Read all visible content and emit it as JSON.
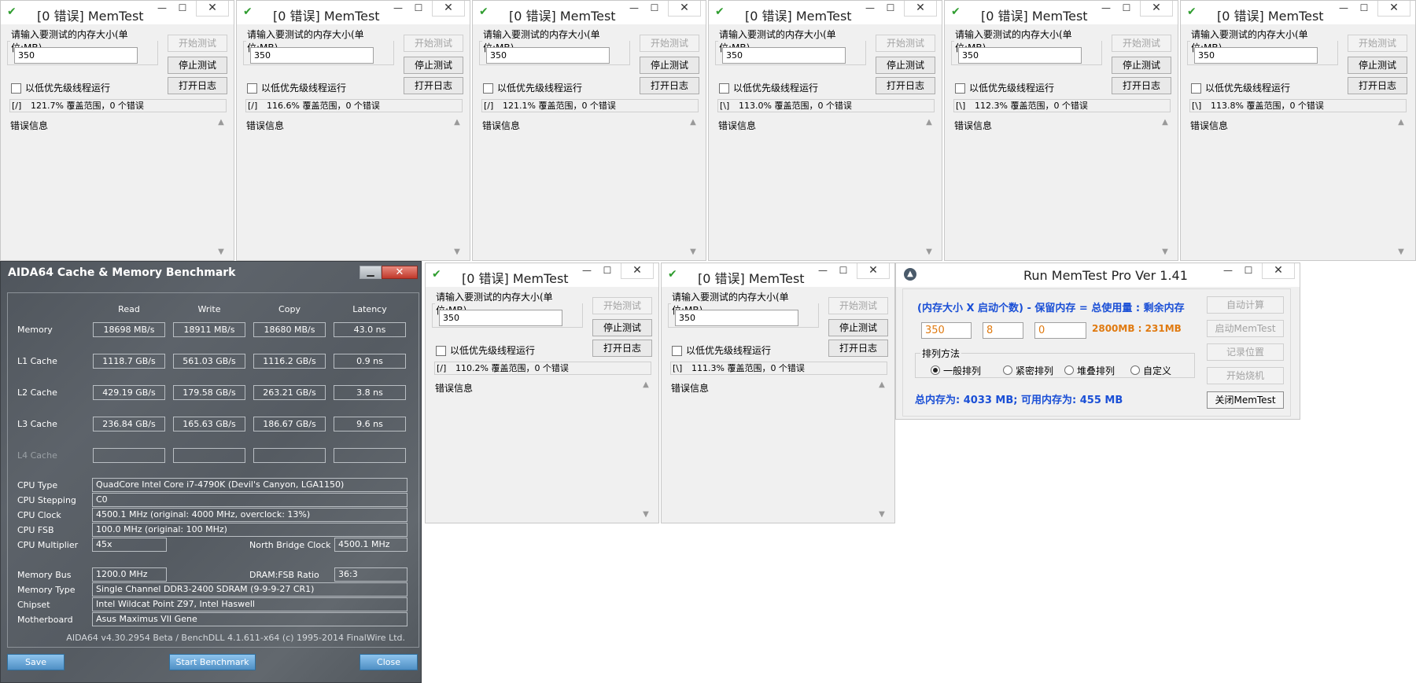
{
  "memtest": {
    "title": "[0 错误] MemTest",
    "size_label": "请输入要测试的内存大小(单位:MB)",
    "size_value": "350",
    "btn_start": "开始测试",
    "btn_stop": "停止测试",
    "btn_log": "打开日志",
    "low_priority": "以低优先级线程运行",
    "error_label": "错误信息",
    "windows": [
      {
        "spinner": "[/]",
        "status": "121.7% 覆盖范围，0 个错误"
      },
      {
        "spinner": "[/]",
        "status": "116.6% 覆盖范围，0 个错误"
      },
      {
        "spinner": "[/]",
        "status": "121.1% 覆盖范围，0 个错误"
      },
      {
        "spinner": "[\\]",
        "status": "113.0% 覆盖范围，0 个错误"
      },
      {
        "spinner": "[\\]",
        "status": "112.3% 覆盖范围，0 个错误"
      },
      {
        "spinner": "[\\]",
        "status": "113.8% 覆盖范围，0 个错误"
      },
      {
        "spinner": "[/]",
        "status": "110.2% 覆盖范围，0 个错误"
      },
      {
        "spinner": "[\\]",
        "status": "111.3% 覆盖范围，0 个错误"
      }
    ]
  },
  "aida": {
    "title": "AIDA64 Cache & Memory Benchmark",
    "columns": {
      "read": "Read",
      "write": "Write",
      "copy": "Copy",
      "latency": "Latency"
    },
    "rows": [
      {
        "label": "Memory",
        "read": "18698 MB/s",
        "write": "18911 MB/s",
        "copy": "18680 MB/s",
        "latency": "43.0 ns"
      },
      {
        "label": "L1 Cache",
        "read": "1118.7 GB/s",
        "write": "561.03 GB/s",
        "copy": "1116.2 GB/s",
        "latency": "0.9 ns"
      },
      {
        "label": "L2 Cache",
        "read": "429.19 GB/s",
        "write": "179.58 GB/s",
        "copy": "263.21 GB/s",
        "latency": "3.8 ns"
      },
      {
        "label": "L3 Cache",
        "read": "236.84 GB/s",
        "write": "165.63 GB/s",
        "copy": "186.67 GB/s",
        "latency": "9.6 ns"
      },
      {
        "label": "L4 Cache",
        "read": "",
        "write": "",
        "copy": "",
        "latency": ""
      }
    ],
    "info": {
      "cpu_type_label": "CPU Type",
      "cpu_type": "QuadCore Intel Core i7-4790K  (Devil's Canyon, LGA1150)",
      "cpu_stepping_label": "CPU Stepping",
      "cpu_stepping": "C0",
      "cpu_clock_label": "CPU Clock",
      "cpu_clock": "4500.1 MHz  (original: 4000 MHz, overclock: 13%)",
      "cpu_fsb_label": "CPU FSB",
      "cpu_fsb": "100.0 MHz  (original: 100 MHz)",
      "cpu_mult_label": "CPU Multiplier",
      "cpu_mult": "45x",
      "nb_clock_label": "North Bridge Clock",
      "nb_clock": "4500.1 MHz",
      "mem_bus_label": "Memory Bus",
      "mem_bus": "1200.0 MHz",
      "dram_fsb_label": "DRAM:FSB Ratio",
      "dram_fsb": "36:3",
      "mem_type_label": "Memory Type",
      "mem_type": "Single Channel DDR3-2400 SDRAM  (9-9-9-27 CR1)",
      "chipset_label": "Chipset",
      "chipset": "Intel Wildcat Point Z97, Intel Haswell",
      "mobo_label": "Motherboard",
      "mobo": "Asus Maximus VII Gene"
    },
    "footer": "AIDA64 v4.30.2954 Beta / BenchDLL 4.1.611-x64  (c) 1995-2014 FinalWire Ltd.",
    "btn_save": "Save",
    "btn_start": "Start Benchmark",
    "btn_close": "Close"
  },
  "rmp": {
    "title": "Run MemTest Pro Ver 1.41",
    "formula": "(内存大小 X 启动个数) - 保留内存 =  总使用量 : 剩余内存",
    "size": "350",
    "count": "8",
    "reserve": "0",
    "result": "2800MB : 231MB",
    "order_label": "排列方法",
    "orders": [
      "一般排列",
      "紧密排列",
      "堆叠排列",
      "自定义"
    ],
    "total": "总内存为: 4033 MB; 可用内存为: 455 MB",
    "btn_auto": "自动计算",
    "btn_start": "启动MemTest",
    "btn_record": "记录位置",
    "btn_burn": "开始烧机",
    "btn_close": "关闭MemTest"
  },
  "colors": {
    "accent_blue": "#1a4fd6",
    "accent_orange": "#e07a10",
    "ok_green": "#2f9d2f"
  }
}
